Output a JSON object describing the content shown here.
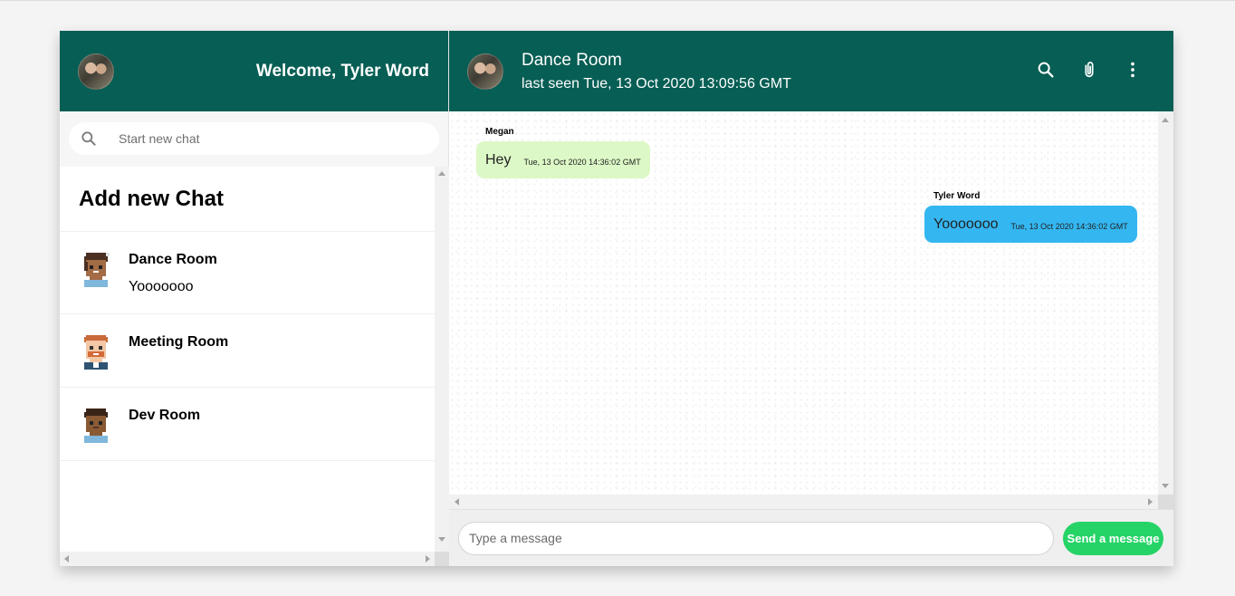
{
  "sidebar": {
    "welcome": "Welcome, Tyler Word",
    "search_placeholder": "Start new chat",
    "add_chat": "Add new Chat",
    "chats": [
      {
        "name": "Dance Room",
        "last_message": "Yooooooo"
      },
      {
        "name": "Meeting Room",
        "last_message": ""
      },
      {
        "name": "Dev Room",
        "last_message": ""
      }
    ]
  },
  "chat": {
    "room_name": "Dance Room",
    "last_seen": "last seen Tue, 13 Oct 2020 13:09:56 GMT",
    "messages": [
      {
        "sender": "Megan",
        "text": "Hey",
        "time": "Tue, 13 Oct 2020 14:36:02 GMT",
        "direction": "received"
      },
      {
        "sender": "Tyler Word",
        "text": "Yooooooo",
        "time": "Tue, 13 Oct 2020 14:36:02 GMT",
        "direction": "sent"
      }
    ],
    "input_placeholder": "Type a message",
    "send_label": "Send a message"
  },
  "colors": {
    "header": "#075e54",
    "received_bubble": "#dcf8c6",
    "sent_bubble": "#34b7f1",
    "send_button": "#25d366"
  },
  "icons": [
    "search-icon",
    "paperclip-icon",
    "more-vertical-icon",
    "avatar"
  ]
}
